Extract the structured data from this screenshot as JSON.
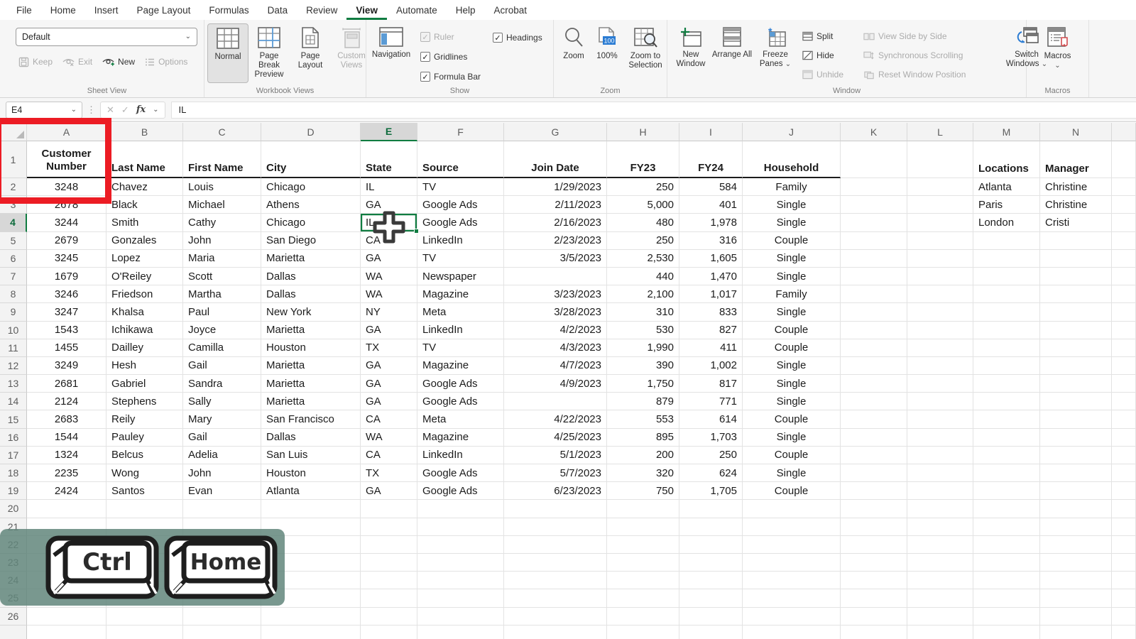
{
  "ribbon": {
    "tabs": [
      "File",
      "Home",
      "Insert",
      "Page Layout",
      "Formulas",
      "Data",
      "Review",
      "View",
      "Automate",
      "Help",
      "Acrobat"
    ],
    "active_tab": "View",
    "sheet_view": {
      "label": "Sheet View",
      "dropdown": "Default",
      "keep": "Keep",
      "exit": "Exit",
      "new": "New",
      "options": "Options"
    },
    "workbook_views": {
      "label": "Workbook Views",
      "normal": "Normal",
      "page_break_preview": "Page Break Preview",
      "page_layout": "Page Layout",
      "custom_views": "Custom Views"
    },
    "show": {
      "label": "Show",
      "navigation": "Navigation",
      "ruler": "Ruler",
      "gridlines": "Gridlines",
      "formula_bar": "Formula Bar",
      "headings": "Headings"
    },
    "zoom": {
      "label": "Zoom",
      "zoom": "Zoom",
      "hundred": "100%",
      "badge": "100",
      "zoom_to_selection": "Zoom to Selection"
    },
    "window": {
      "label": "Window",
      "new_window": "New Window",
      "arrange_all": "Arrange All",
      "freeze_panes": "Freeze Panes",
      "split": "Split",
      "hide": "Hide",
      "unhide": "Unhide",
      "view_side_by_side": "View Side by Side",
      "synchronous_scrolling": "Synchronous Scrolling",
      "reset_window_position": "Reset Window Position",
      "switch_windows": "Switch Windows"
    },
    "macros": {
      "label": "Macros",
      "button": "Macros"
    }
  },
  "formula_bar": {
    "name_box": "E4",
    "value": "IL"
  },
  "sheet": {
    "visible_columns": [
      "A",
      "B",
      "C",
      "D",
      "E",
      "F",
      "G",
      "H",
      "I",
      "J",
      "K",
      "L",
      "M",
      "N"
    ],
    "selected_cell": "E4",
    "selected_column": "E",
    "selected_row": 4,
    "visible_row_count": 26,
    "rows": {
      "1": [
        "Customer Number",
        "Last Name",
        "First Name",
        "City",
        "State",
        "Source",
        "Join Date",
        "FY23",
        "FY24",
        "Household",
        "",
        "",
        "Locations",
        "Manager"
      ],
      "2": [
        "3248",
        "Chavez",
        "Louis",
        "Chicago",
        "IL",
        "TV",
        "1/29/2023",
        "250",
        "584",
        "Family",
        "",
        "",
        "Atlanta",
        "Christine"
      ],
      "3": [
        "2678",
        "Black",
        "Michael",
        "Athens",
        "GA",
        "Google Ads",
        "2/11/2023",
        "5,000",
        "401",
        "Single",
        "",
        "",
        "Paris",
        "Christine"
      ],
      "4": [
        "3244",
        "Smith",
        "Cathy",
        "Chicago",
        "IL",
        "Google Ads",
        "2/16/2023",
        "480",
        "1,978",
        "Single",
        "",
        "",
        "London",
        "Cristi"
      ],
      "5": [
        "2679",
        "Gonzales",
        "John",
        "San Diego",
        "CA",
        "LinkedIn",
        "2/23/2023",
        "250",
        "316",
        "Couple",
        "",
        "",
        "",
        ""
      ],
      "6": [
        "3245",
        "Lopez",
        "Maria",
        "Marietta",
        "GA",
        "TV",
        "3/5/2023",
        "2,530",
        "1,605",
        "Single",
        "",
        "",
        "",
        ""
      ],
      "7": [
        "1679",
        "O'Reiley",
        "Scott",
        "Dallas",
        "WA",
        "Newspaper",
        "",
        "440",
        "1,470",
        "Single",
        "",
        "",
        "",
        ""
      ],
      "8": [
        "3246",
        "Friedson",
        "Martha",
        "Dallas",
        "WA",
        "Magazine",
        "3/23/2023",
        "2,100",
        "1,017",
        "Family",
        "",
        "",
        "",
        ""
      ],
      "9": [
        "3247",
        "Khalsa",
        "Paul",
        "New York",
        "NY",
        "Meta",
        "3/28/2023",
        "310",
        "833",
        "Single",
        "",
        "",
        "",
        ""
      ],
      "10": [
        "1543",
        "Ichikawa",
        "Joyce",
        "Marietta",
        "GA",
        "LinkedIn",
        "4/2/2023",
        "530",
        "827",
        "Couple",
        "",
        "",
        "",
        ""
      ],
      "11": [
        "1455",
        "Dailley",
        "Camilla",
        "Houston",
        "TX",
        "TV",
        "4/3/2023",
        "1,990",
        "411",
        "Couple",
        "",
        "",
        "",
        ""
      ],
      "12": [
        "3249",
        "Hesh",
        "Gail",
        "Marietta",
        "GA",
        "Magazine",
        "4/7/2023",
        "390",
        "1,002",
        "Single",
        "",
        "",
        "",
        ""
      ],
      "13": [
        "2681",
        "Gabriel",
        "Sandra",
        "Marietta",
        "GA",
        "Google Ads",
        "4/9/2023",
        "1,750",
        "817",
        "Single",
        "",
        "",
        "",
        ""
      ],
      "14": [
        "2124",
        "Stephens",
        "Sally",
        "Marietta",
        "GA",
        "Google Ads",
        "",
        "879",
        "771",
        "Single",
        "",
        "",
        "",
        ""
      ],
      "15": [
        "2683",
        "Reily",
        "Mary",
        "San Francisco",
        "CA",
        "Meta",
        "4/22/2023",
        "553",
        "614",
        "Couple",
        "",
        "",
        "",
        ""
      ],
      "16": [
        "1544",
        "Pauley",
        "Gail",
        "Dallas",
        "WA",
        "Magazine",
        "4/25/2023",
        "895",
        "1,703",
        "Single",
        "",
        "",
        "",
        ""
      ],
      "17": [
        "1324",
        "Belcus",
        "Adelia",
        "San Luis",
        "CA",
        "LinkedIn",
        "5/1/2023",
        "200",
        "250",
        "Couple",
        "",
        "",
        "",
        ""
      ],
      "18": [
        "2235",
        "Wong",
        "John",
        "Houston",
        "TX",
        "Google Ads",
        "5/7/2023",
        "320",
        "624",
        "Single",
        "",
        "",
        "",
        ""
      ],
      "19": [
        "2424",
        "Santos",
        "Evan",
        "Atlanta",
        "GA",
        "Google Ads",
        "6/23/2023",
        "750",
        "1,705",
        "Couple",
        "",
        "",
        "",
        ""
      ]
    }
  },
  "annotations": {
    "keys": [
      "Ctrl",
      "Home"
    ]
  },
  "colors": {
    "excel_green": "#107C41",
    "annotation_red": "#EC1C24",
    "overlay_teal": "#7B9A8F",
    "badge_blue": "#2B7CD3"
  }
}
